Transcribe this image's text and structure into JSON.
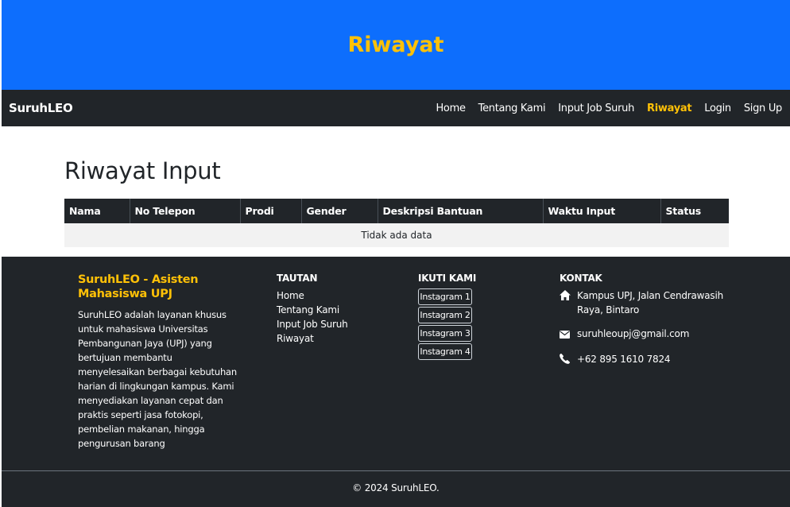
{
  "hero": {
    "title": "Riwayat"
  },
  "navbar": {
    "brand": "SuruhLEO",
    "items": [
      {
        "label": "Home",
        "active": false
      },
      {
        "label": "Tentang Kami",
        "active": false
      },
      {
        "label": "Input Job Suruh",
        "active": false
      },
      {
        "label": "Riwayat",
        "active": true
      },
      {
        "label": "Login",
        "active": false
      },
      {
        "label": "Sign Up",
        "active": false
      }
    ]
  },
  "main": {
    "title": "Riwayat Input",
    "table": {
      "columns": [
        "Nama",
        "No Telepon",
        "Prodi",
        "Gender",
        "Deskripsi Bantuan",
        "Waktu Input",
        "Status"
      ],
      "empty_text": "Tidak ada data"
    }
  },
  "footer": {
    "about": {
      "title": "SuruhLEO - Asisten Mahasiswa UPJ",
      "text": "SuruhLEO adalah layanan khusus untuk mahasiswa Universitas Pembangunan Jaya (UPJ) yang bertujuan membantu menyelesaikan berbagai kebutuhan harian di lingkungan kampus. Kami menyediakan layanan cepat dan praktis seperti jasa fotokopi, pembelian makanan, hingga pengurusan barang"
    },
    "links": {
      "heading": "TAUTAN",
      "items": [
        "Home",
        "Tentang Kami",
        "Input Job Suruh",
        "Riwayat"
      ]
    },
    "social": {
      "heading": "IKUTI KAMI",
      "items": [
        "Instagram 1",
        "Instagram 2",
        "Instagram 3",
        "Instagram 4"
      ]
    },
    "contact": {
      "heading": "KONTAK",
      "address": "Kampus UPJ, Jalan Cendrawasih Raya, Bintaro",
      "email": "suruhleoupj@gmail.com",
      "phone": "+62 895 1610 7824"
    },
    "copyright": "© 2024 SuruhLEO."
  },
  "colors": {
    "primary": "#0d6efd",
    "accent": "#ffc107",
    "dark": "#212529"
  },
  "icons": {
    "address": "home-icon",
    "email": "envelope-icon",
    "phone": "phone-icon"
  }
}
